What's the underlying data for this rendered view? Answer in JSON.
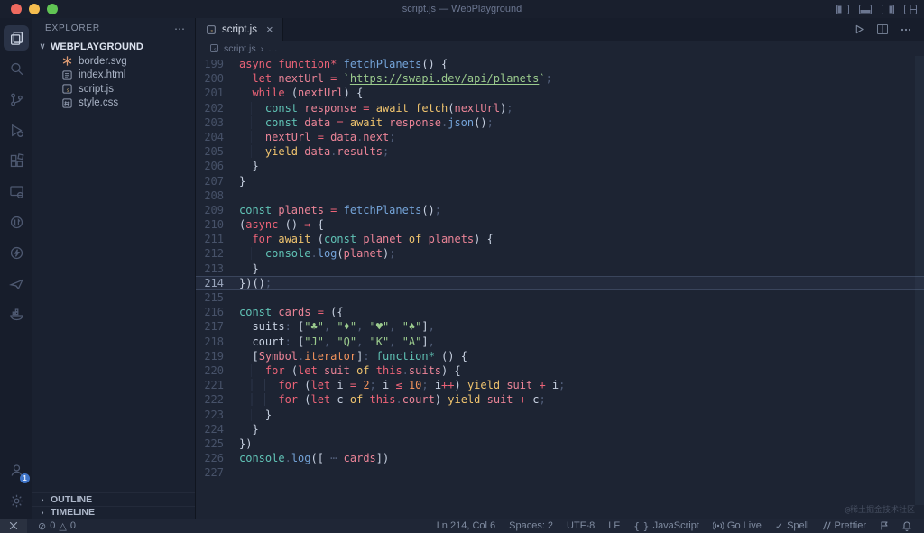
{
  "window": {
    "title": "script.js — WebPlayground"
  },
  "activity_bar": {
    "badge": "1",
    "items": [
      {
        "name": "explorer",
        "active": true
      },
      {
        "name": "search",
        "active": false
      },
      {
        "name": "source-control",
        "active": false
      },
      {
        "name": "run-and-debug",
        "active": false
      },
      {
        "name": "extensions",
        "active": false
      },
      {
        "name": "live-preview",
        "active": false
      },
      {
        "name": "sync",
        "active": false
      },
      {
        "name": "thunder-client",
        "active": false
      },
      {
        "name": "paper-plane",
        "active": false
      },
      {
        "name": "docker",
        "active": false
      },
      {
        "name": "accounts",
        "active": false
      },
      {
        "name": "settings",
        "active": false
      }
    ]
  },
  "sidebar": {
    "header": "EXPLORER",
    "more": "⋯",
    "chevron_open": "∨",
    "chevron_closed": "›",
    "folder": "WEBPLAYGROUND",
    "files": [
      {
        "name": "border.svg"
      },
      {
        "name": "index.html"
      },
      {
        "name": "script.js"
      },
      {
        "name": "style.css"
      }
    ],
    "sections": [
      {
        "label": "OUTLINE"
      },
      {
        "label": "TIMELINE"
      }
    ]
  },
  "tab": {
    "label": "script.js",
    "close": "×"
  },
  "breadcrumb": {
    "file": "script.js",
    "separator": "›",
    "more": "…"
  },
  "editor": {
    "lines": [
      {
        "n": 199,
        "t": [
          [
            "kw",
            "async "
          ],
          [
            "kw",
            "function* "
          ],
          [
            "fn",
            "fetchPlanets"
          ],
          [
            "tx",
            "() {"
          ]
        ]
      },
      {
        "n": 200,
        "t": [
          [
            "tx",
            "  "
          ],
          [
            "kw",
            "let "
          ],
          [
            "vr",
            "nextUrl "
          ],
          [
            "kw",
            "= "
          ],
          [
            "st",
            "`"
          ],
          [
            "lk",
            "https://swapi.dev/api/planets"
          ],
          [
            "st",
            "`"
          ],
          [
            "dm",
            ";"
          ]
        ]
      },
      {
        "n": 201,
        "t": [
          [
            "tx",
            "  "
          ],
          [
            "kw",
            "while "
          ],
          [
            "tx",
            "("
          ],
          [
            "vr",
            "nextUrl"
          ],
          [
            "tx",
            ") {"
          ]
        ]
      },
      {
        "n": 202,
        "t": [
          [
            "ind",
            "  "
          ],
          [
            "tx",
            "  "
          ],
          [
            "tl",
            "const "
          ],
          [
            "vr",
            "response "
          ],
          [
            "kw",
            "= "
          ],
          [
            "gd",
            "await "
          ],
          [
            "gd",
            "fetch"
          ],
          [
            "tx",
            "("
          ],
          [
            "vr",
            "nextUrl"
          ],
          [
            "tx",
            ")"
          ],
          [
            "dm",
            ";"
          ]
        ]
      },
      {
        "n": 203,
        "t": [
          [
            "ind",
            "  "
          ],
          [
            "tx",
            "  "
          ],
          [
            "tl",
            "const "
          ],
          [
            "vr",
            "data "
          ],
          [
            "kw",
            "= "
          ],
          [
            "gd",
            "await "
          ],
          [
            "vr",
            "response"
          ],
          [
            "dm",
            "."
          ],
          [
            "fn",
            "json"
          ],
          [
            "tx",
            "()"
          ],
          [
            "dm",
            ";"
          ]
        ]
      },
      {
        "n": 204,
        "t": [
          [
            "ind",
            "  "
          ],
          [
            "tx",
            "  "
          ],
          [
            "vr",
            "nextUrl "
          ],
          [
            "kw",
            "= "
          ],
          [
            "vr",
            "data"
          ],
          [
            "dm",
            "."
          ],
          [
            "vr",
            "next"
          ],
          [
            "dm",
            ";"
          ]
        ]
      },
      {
        "n": 205,
        "t": [
          [
            "ind",
            "  "
          ],
          [
            "tx",
            "  "
          ],
          [
            "gd",
            "yield "
          ],
          [
            "vr",
            "data"
          ],
          [
            "dm",
            "."
          ],
          [
            "vr",
            "results"
          ],
          [
            "dm",
            ";"
          ]
        ]
      },
      {
        "n": 206,
        "t": [
          [
            "tx",
            "  }"
          ]
        ]
      },
      {
        "n": 207,
        "t": [
          [
            "tx",
            "}"
          ]
        ]
      },
      {
        "n": 208,
        "t": []
      },
      {
        "n": 209,
        "t": [
          [
            "tl",
            "const "
          ],
          [
            "vr",
            "planets "
          ],
          [
            "kw",
            "= "
          ],
          [
            "fn",
            "fetchPlanets"
          ],
          [
            "tx",
            "()"
          ],
          [
            "dm",
            ";"
          ]
        ]
      },
      {
        "n": 210,
        "t": [
          [
            "tx",
            "("
          ],
          [
            "kw",
            "async "
          ],
          [
            "tx",
            "() "
          ],
          [
            "kw",
            "⇒"
          ],
          [
            "tx",
            " {"
          ]
        ]
      },
      {
        "n": 211,
        "t": [
          [
            "tx",
            "  "
          ],
          [
            "kw",
            "for "
          ],
          [
            "gd",
            "await "
          ],
          [
            "tx",
            "("
          ],
          [
            "tl",
            "const "
          ],
          [
            "vr",
            "planet "
          ],
          [
            "gd",
            "of "
          ],
          [
            "vr",
            "planets"
          ],
          [
            "tx",
            ") {"
          ]
        ]
      },
      {
        "n": 212,
        "t": [
          [
            "ind",
            "  "
          ],
          [
            "tx",
            "  "
          ],
          [
            "tl",
            "console"
          ],
          [
            "dm",
            "."
          ],
          [
            "fn",
            "log"
          ],
          [
            "tx",
            "("
          ],
          [
            "vr",
            "planet"
          ],
          [
            "tx",
            ")"
          ],
          [
            "dm",
            ";"
          ]
        ]
      },
      {
        "n": 213,
        "t": [
          [
            "tx",
            "  }"
          ]
        ]
      },
      {
        "n": 214,
        "c": true,
        "t": [
          [
            "tx",
            "})()"
          ],
          [
            "dm",
            ";"
          ]
        ]
      },
      {
        "n": 215,
        "t": []
      },
      {
        "n": 216,
        "t": [
          [
            "tl",
            "const "
          ],
          [
            "vr",
            "cards "
          ],
          [
            "kw",
            "= "
          ],
          [
            "tx",
            "({"
          ]
        ]
      },
      {
        "n": 217,
        "t": [
          [
            "tx",
            "  suits"
          ],
          [
            "dm",
            ": "
          ],
          [
            "tx",
            "["
          ],
          [
            "st",
            "\"♣\""
          ],
          [
            "dm",
            ", "
          ],
          [
            "st",
            "\"♦\""
          ],
          [
            "dm",
            ", "
          ],
          [
            "st",
            "\"♥\""
          ],
          [
            "dm",
            ", "
          ],
          [
            "st",
            "\"♠\""
          ],
          [
            "tx",
            "]"
          ],
          [
            "dm",
            ","
          ]
        ]
      },
      {
        "n": 218,
        "t": [
          [
            "tx",
            "  court"
          ],
          [
            "dm",
            ": "
          ],
          [
            "tx",
            "["
          ],
          [
            "st",
            "\"J\""
          ],
          [
            "dm",
            ", "
          ],
          [
            "st",
            "\"Q\""
          ],
          [
            "dm",
            ", "
          ],
          [
            "st",
            "\"K\""
          ],
          [
            "dm",
            ", "
          ],
          [
            "st",
            "\"A\""
          ],
          [
            "tx",
            "]"
          ],
          [
            "dm",
            ","
          ]
        ]
      },
      {
        "n": 219,
        "t": [
          [
            "tx",
            "  ["
          ],
          [
            "vr",
            "Symbol"
          ],
          [
            "dm",
            "."
          ],
          [
            "or",
            "iterator"
          ],
          [
            "tx",
            "]"
          ],
          [
            "dm",
            ": "
          ],
          [
            "tl",
            "function* "
          ],
          [
            "tx",
            "() {"
          ]
        ]
      },
      {
        "n": 220,
        "t": [
          [
            "ind",
            "  "
          ],
          [
            "tx",
            "  "
          ],
          [
            "kw",
            "for "
          ],
          [
            "tx",
            "("
          ],
          [
            "kw",
            "let "
          ],
          [
            "vr",
            "suit "
          ],
          [
            "gd",
            "of "
          ],
          [
            "kw",
            "this"
          ],
          [
            "dm",
            "."
          ],
          [
            "vr",
            "suits"
          ],
          [
            "tx",
            ") {"
          ]
        ]
      },
      {
        "n": 221,
        "t": [
          [
            "ind",
            "    "
          ],
          [
            "tx",
            "  "
          ],
          [
            "kw",
            "for "
          ],
          [
            "tx",
            "("
          ],
          [
            "kw",
            "let "
          ],
          [
            "tx",
            "i "
          ],
          [
            "kw",
            "= "
          ],
          [
            "nm",
            "2"
          ],
          [
            "dm",
            "; "
          ],
          [
            "tx",
            "i "
          ],
          [
            "kw",
            "≤ "
          ],
          [
            "nm",
            "10"
          ],
          [
            "dm",
            "; "
          ],
          [
            "tx",
            "i"
          ],
          [
            "kw",
            "++"
          ],
          [
            "tx",
            ") "
          ],
          [
            "gd",
            "yield "
          ],
          [
            "vr",
            "suit "
          ],
          [
            "kw",
            "+ "
          ],
          [
            "tx",
            "i"
          ],
          [
            "dm",
            ";"
          ]
        ]
      },
      {
        "n": 222,
        "t": [
          [
            "ind",
            "    "
          ],
          [
            "tx",
            "  "
          ],
          [
            "kw",
            "for "
          ],
          [
            "tx",
            "("
          ],
          [
            "kw",
            "let "
          ],
          [
            "tx",
            "c "
          ],
          [
            "gd",
            "of "
          ],
          [
            "kw",
            "this"
          ],
          [
            "dm",
            "."
          ],
          [
            "vr",
            "court"
          ],
          [
            "tx",
            ") "
          ],
          [
            "gd",
            "yield "
          ],
          [
            "vr",
            "suit "
          ],
          [
            "kw",
            "+ "
          ],
          [
            "tx",
            "c"
          ],
          [
            "dm",
            ";"
          ]
        ]
      },
      {
        "n": 223,
        "t": [
          [
            "ind",
            "  "
          ],
          [
            "tx",
            "  }"
          ]
        ]
      },
      {
        "n": 224,
        "t": [
          [
            "tx",
            "  }"
          ]
        ]
      },
      {
        "n": 225,
        "t": [
          [
            "tx",
            "})"
          ]
        ]
      },
      {
        "n": 226,
        "t": [
          [
            "tl",
            "console"
          ],
          [
            "dm",
            "."
          ],
          [
            "fn",
            "log"
          ],
          [
            "tx",
            "(["
          ],
          [
            "dm",
            " ⋯ "
          ],
          [
            "vr",
            "cards"
          ],
          [
            "tx",
            "])"
          ]
        ]
      },
      {
        "n": 227,
        "t": []
      }
    ]
  },
  "status_bar": {
    "errors_icon": "⊘",
    "errors": "0",
    "warnings_icon": "△",
    "warnings": "0",
    "position": "Ln 214, Col 6",
    "indent": "Spaces: 2",
    "encoding": "UTF-8",
    "eol": "LF",
    "language_icon": "{ }",
    "language": "JavaScript",
    "go_live": "Go Live",
    "spell_icon": "✓",
    "spell": "Spell",
    "prettier": "Prettier"
  },
  "watermark": "@稀土掘金技术社区"
}
